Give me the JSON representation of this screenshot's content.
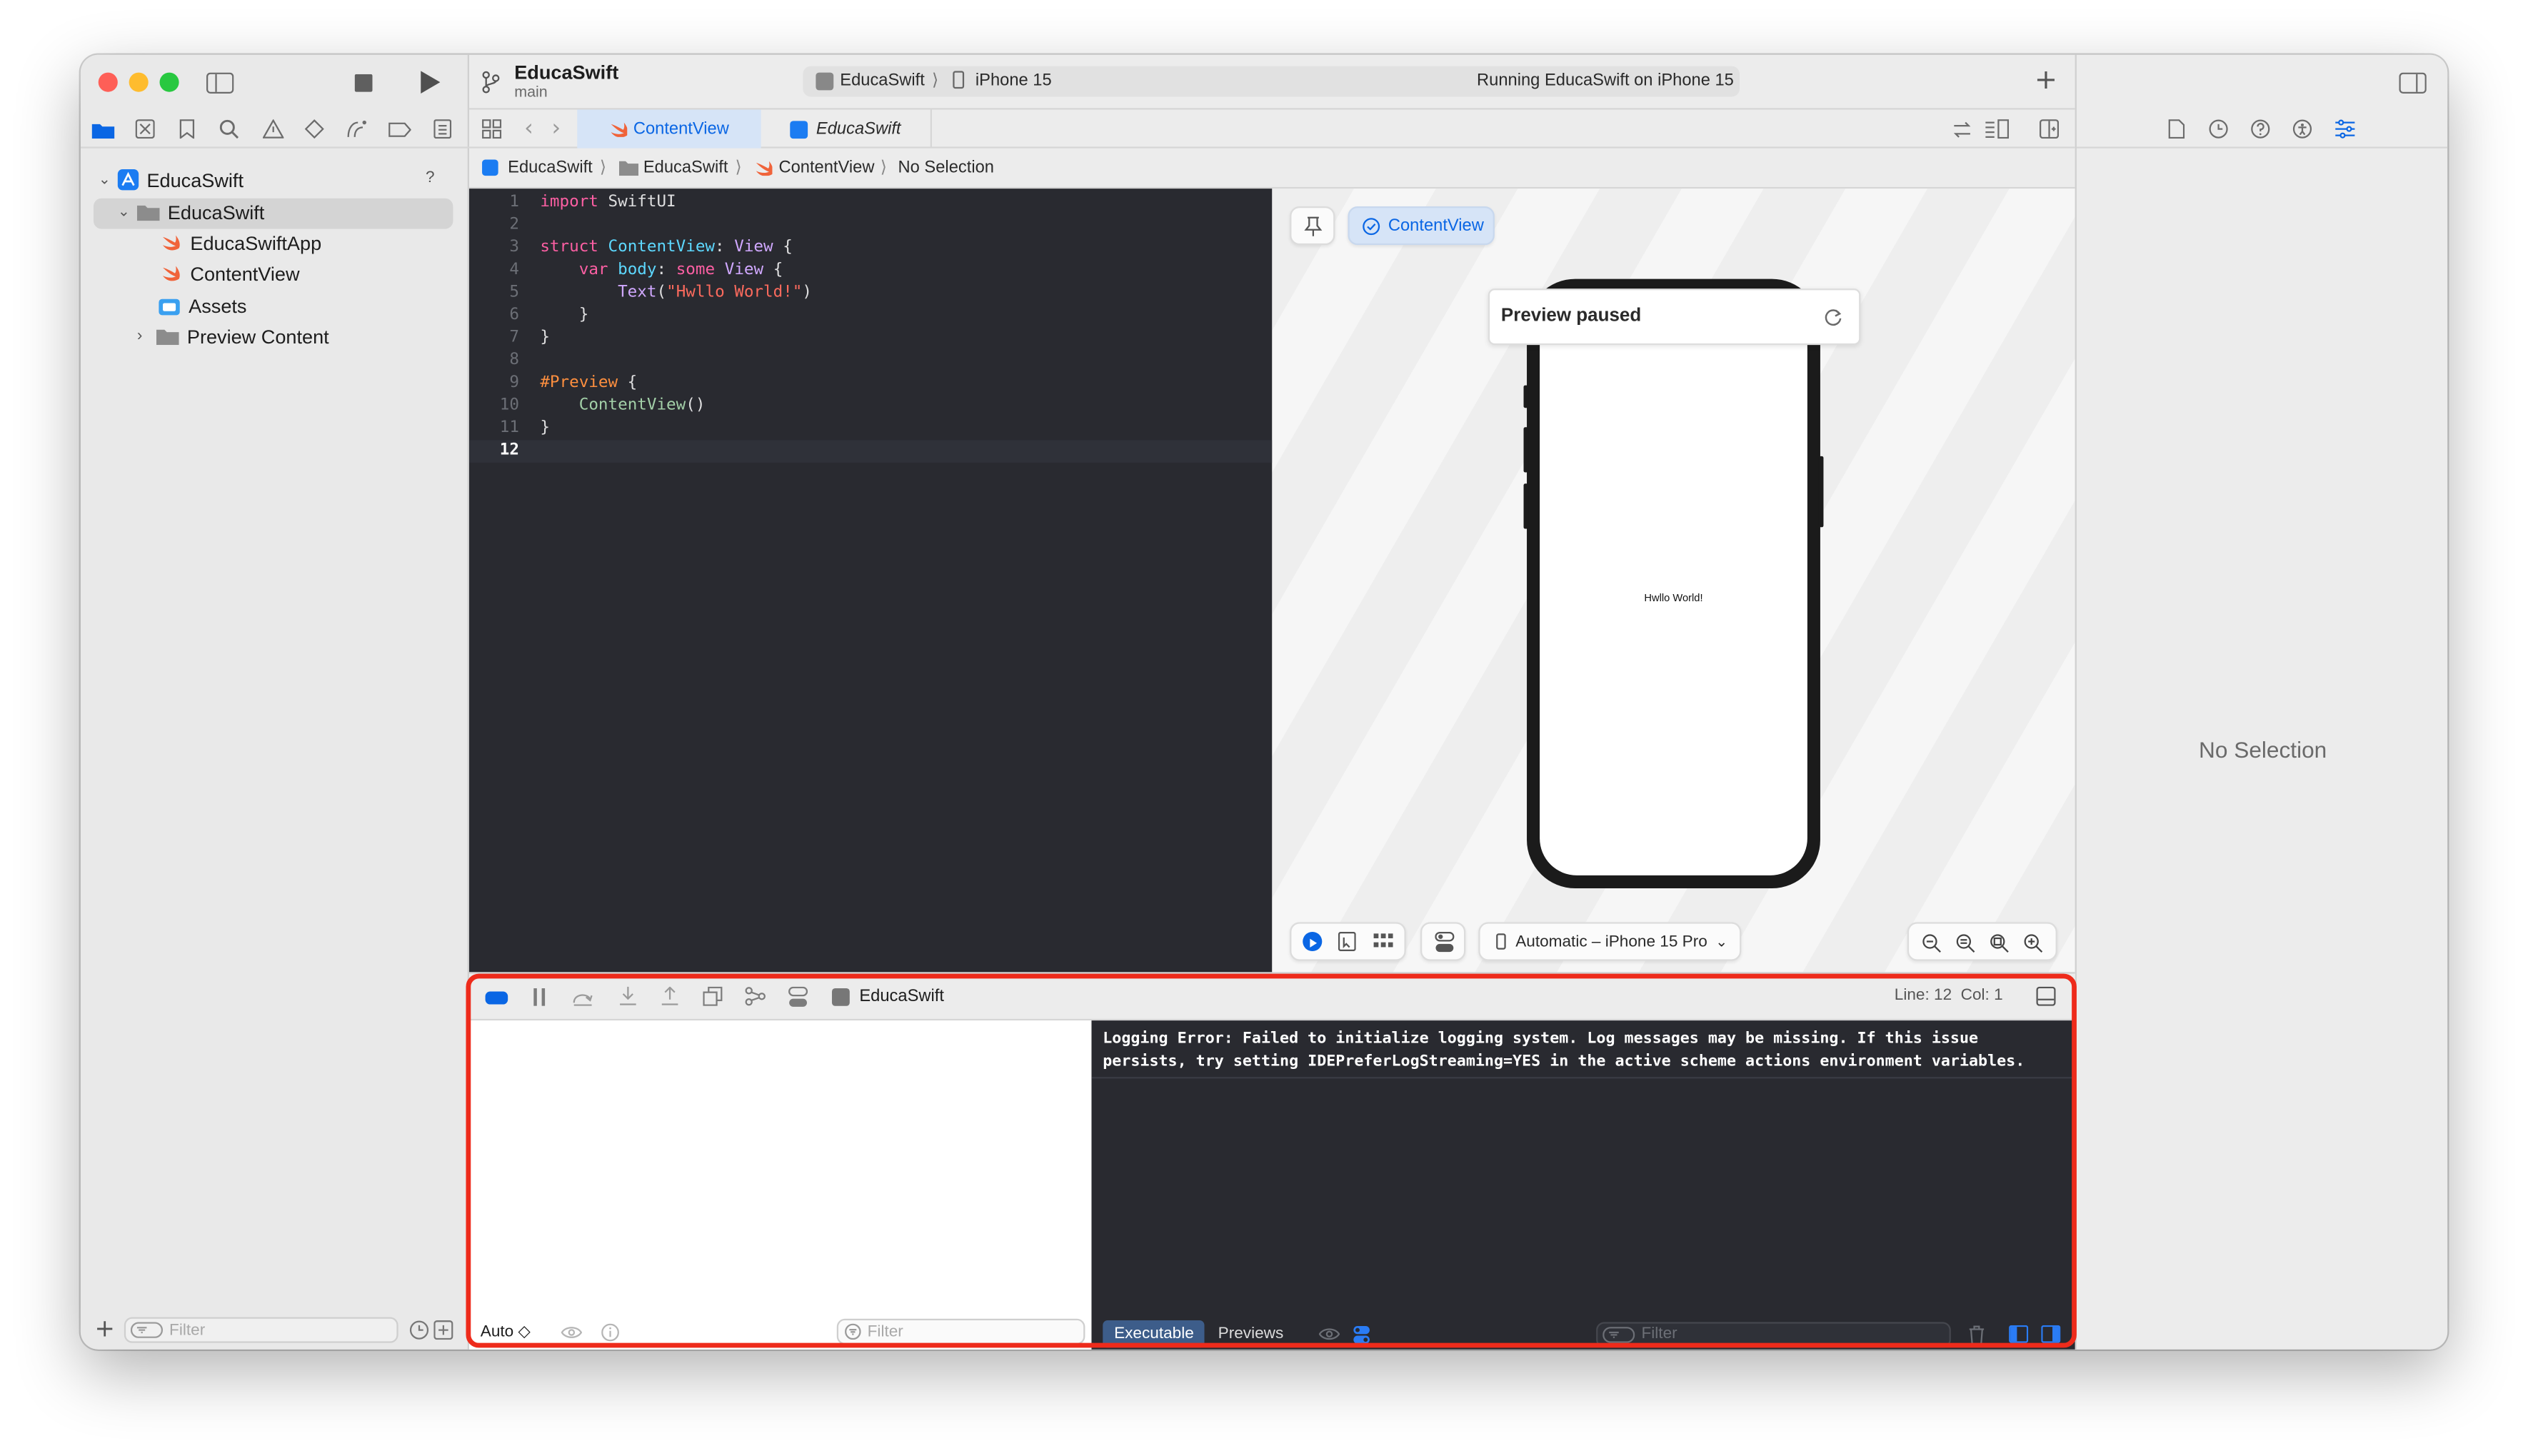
{
  "window": {
    "project": "EducaSwift",
    "branch": "main",
    "scheme": "EducaSwift",
    "destination": "iPhone 15",
    "status": "Running EducaSwift on iPhone 15"
  },
  "sidebar": {
    "tree": [
      {
        "label": "EducaSwift",
        "badge": "?"
      },
      {
        "label": "EducaSwift"
      },
      {
        "label": "EducaSwiftApp"
      },
      {
        "label": "ContentView"
      },
      {
        "label": "Assets"
      },
      {
        "label": "Preview Content"
      }
    ],
    "filter_placeholder": "Filter"
  },
  "tabs": [
    {
      "label": "ContentView",
      "active": true
    },
    {
      "label": "EducaSwift",
      "active": false
    }
  ],
  "jumpbar": [
    "EducaSwift",
    "EducaSwift",
    "ContentView",
    "No Selection"
  ],
  "code": {
    "lines": [
      {
        "n": "1",
        "text": "import SwiftUI"
      },
      {
        "n": "2",
        "text": ""
      },
      {
        "n": "3",
        "text": "struct ContentView: View {"
      },
      {
        "n": "4",
        "text": "    var body: some View {"
      },
      {
        "n": "5",
        "text": "        Text(\"Hwllo World!\")"
      },
      {
        "n": "6",
        "text": "    }"
      },
      {
        "n": "7",
        "text": "}"
      },
      {
        "n": "8",
        "text": ""
      },
      {
        "n": "9",
        "text": "#Preview {"
      },
      {
        "n": "10",
        "text": "    ContentView()"
      },
      {
        "n": "11",
        "text": "}"
      },
      {
        "n": "12",
        "text": ""
      }
    ],
    "current_line": "12"
  },
  "preview": {
    "chip_label": "ContentView",
    "paused_title": "Preview paused",
    "screen_text": "Hwllo World!",
    "device_menu": "Automatic – iPhone 15 Pro"
  },
  "inspector": {
    "empty_label": "No Selection"
  },
  "debug": {
    "target": "EducaSwift",
    "position": "Line: 12  Col: 1",
    "console_message": "Logging Error: Failed to initialize logging system. Log messages may be missing. If this issue\npersists, try setting IDEPreferLogStreaming=YES in the active scheme actions environment variables.",
    "auto_label": "Auto ◇",
    "variables_filter": "Filter",
    "console_filter": "Filter",
    "tabs": [
      "Executable",
      "Previews"
    ]
  },
  "colors": {
    "accent": "#0a66e4",
    "editor_bg": "#292a30",
    "highlight_box": "#ee2b1b",
    "swift_orange": "#f0633a",
    "keyword": "#fc5fa3",
    "type": "#d0a8ff",
    "string": "#fc6a5d",
    "function": "#a3d0a8"
  }
}
